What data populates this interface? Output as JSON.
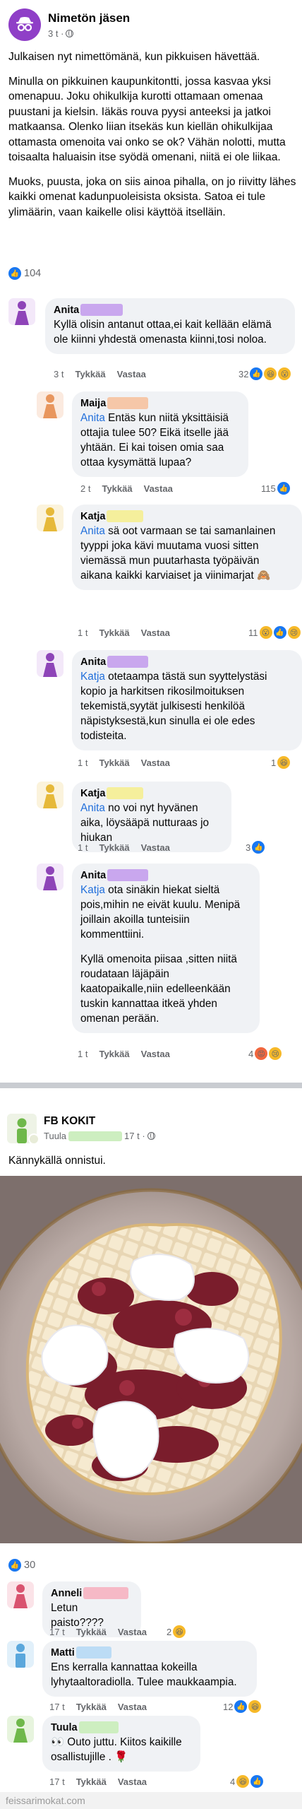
{
  "post1": {
    "author": "Nimetön jäsen",
    "time": "3 t ·",
    "paragraphs": [
      "Julkaisen nyt nimettömänä, kun pikkuisen hävettää.",
      "Minulla on pikkuinen kaupunkitontti, jossa kasvaa yksi omenapuu. Joku ohikulkija kurotti ottamaan omenaa puustani ja kielsin. Iäkäs rouva pyysi anteeksi ja jatkoi matkaansa. Olenko liian itsekäs kun kiellän ohikulkijaa ottamasta omenoita vai onko se ok? Vähän nolotti, mutta toisaalta haluaisin itse syödä omenani, niitä ei ole liikaa.",
      "Muoks, puusta, joka on siis ainoa pihalla, on jo riivitty lähes kaikki omenat kadunpuoleisista oksista. Satoa ei tule ylimäärin, vaan kaikelle olisi käyttöä itselläin."
    ],
    "reaction_count": "104"
  },
  "comments1": [
    {
      "name": "Anita",
      "name_blur_color": "#c9a7ee",
      "avatar_color": "#8e44b8",
      "avatar_bg": "#f3e8f9",
      "mention": "",
      "text": "Kyllä olisin antanut ottaa,ei kait kellään elämä ole kiinni yhdestä omenasta kiinni,tosi noloa.",
      "time": "3 t",
      "like": "Tykkää",
      "reply": "Vastaa",
      "reaction_count": "32",
      "reaction_icons": [
        "like",
        "haha",
        "wow"
      ]
    },
    {
      "name": "Maija",
      "name_blur_color": "#f6c7a8",
      "avatar_color": "#e8965e",
      "avatar_bg": "#fbeadf",
      "mention": "Anita",
      "text": " Entäs kun niitä yksittäisiä ottajia tulee 50? Eikä itselle jää yhtään. Ei kai toisen omia saa ottaa kysymättä lupaa?",
      "time": "2 t",
      "like": "Tykkää",
      "reply": "Vastaa",
      "reaction_count": "115",
      "reaction_icons": [
        "like"
      ]
    },
    {
      "name": "Katja",
      "name_blur_color": "#f5ef9c",
      "avatar_color": "#e6b93a",
      "avatar_bg": "#fbf3dc",
      "mention": "Anita",
      "text": " sä oot varmaan se tai samanlainen tyyppi joka kävi muutama vuosi sitten viemässä mun puutarhasta työpäivän aikana kaikki karviaiset ja viinimarjat 🙈",
      "time": "1 t",
      "like": "Tykkää",
      "reply": "Vastaa",
      "reaction_count": "11",
      "reaction_icons": [
        "wow",
        "like",
        "sad"
      ]
    },
    {
      "name": "Anita",
      "name_blur_color": "#c9a7ee",
      "avatar_color": "#8e44b8",
      "avatar_bg": "#f3e8f9",
      "mention": "Katja",
      "text": " otetaampa tästä sun syyttelystäsi kopio ja harkitsen rikosilmoituksen tekemistä,syytät julkisesti henkilöä näpistyksestä,kun sinulla ei ole edes todisteita.",
      "time": "1 t",
      "like": "Tykkää",
      "reply": "Vastaa",
      "reaction_count": "1",
      "reaction_icons": [
        "haha"
      ]
    },
    {
      "name": "Katja",
      "name_blur_color": "#f5ef9c",
      "avatar_color": "#e6b93a",
      "avatar_bg": "#fbf3dc",
      "mention": "Anita",
      "text": " no voi nyt hyvänen aika, löysääpä nutturaas jo hiukan",
      "time": "1 t",
      "like": "Tykkää",
      "reply": "Vastaa",
      "reaction_count": "3",
      "reaction_icons": [
        "like"
      ]
    },
    {
      "name": "Anita",
      "name_blur_color": "#c9a7ee",
      "avatar_color": "#8e44b8",
      "avatar_bg": "#f3e8f9",
      "mention": "Katja",
      "text": " ota sinäkin hiekat sieltä pois,mihin ne eivät kuulu. Menipä joillain akoilla tunteisiin kommenttiini.",
      "text2": "Kyllä omenoita piisaa ,sitten niitä roudataan läjäpäin kaatopaikalle,niin edelleenkään tuskin kannattaa itkeä yhden omenan perään.",
      "time": "1 t",
      "like": "Tykkää",
      "reply": "Vastaa",
      "reaction_count": "4",
      "reaction_icons": [
        "angry",
        "sad"
      ]
    }
  ],
  "post2": {
    "group_name": "FB KOKIT",
    "member_name": "Tuula",
    "member_blur_color": "#cdeec0",
    "time": "17 t ·",
    "text": "Kännykällä onnistui.",
    "reaction_count": "30"
  },
  "comments2": [
    {
      "name": "Anneli",
      "name_blur_color": "#f6b9c6",
      "avatar_color": "#d9536f",
      "avatar_bg": "#fbe3e8",
      "text": "Letun paisto????",
      "time": "17 t",
      "like": "Tykkää",
      "reply": "Vastaa",
      "reaction_count": "2",
      "reaction_icons": [
        "haha"
      ]
    },
    {
      "name": "Matti",
      "name_blur_color": "#bcdcf5",
      "avatar_color": "#5aa7dc",
      "avatar_bg": "#e1f0fa",
      "text": "Ens kerralla kannattaa kokeilla lyhytaaltoradiolla. Tulee maukkaampia.",
      "time": "17 t",
      "like": "Tykkää",
      "reply": "Vastaa",
      "reaction_count": "12",
      "reaction_icons": [
        "like",
        "haha"
      ]
    },
    {
      "name": "Tuula",
      "name_blur_color": "#cdeec0",
      "avatar_color": "#6fb84a",
      "avatar_bg": "#e7f4de",
      "text": "👀 Outo juttu. Kiitos kaikille osallistujille . 🌹",
      "time": "17 t",
      "like": "Tykkää",
      "reply": "Vastaa",
      "reaction_count": "4",
      "reaction_icons": [
        "haha",
        "like"
      ]
    }
  ],
  "watermark": "feissarimokat.com",
  "colors": {
    "accent": "#1877f2",
    "mention": "#216fdb",
    "bubble": "#f0f2f5",
    "muted": "#65676b"
  }
}
